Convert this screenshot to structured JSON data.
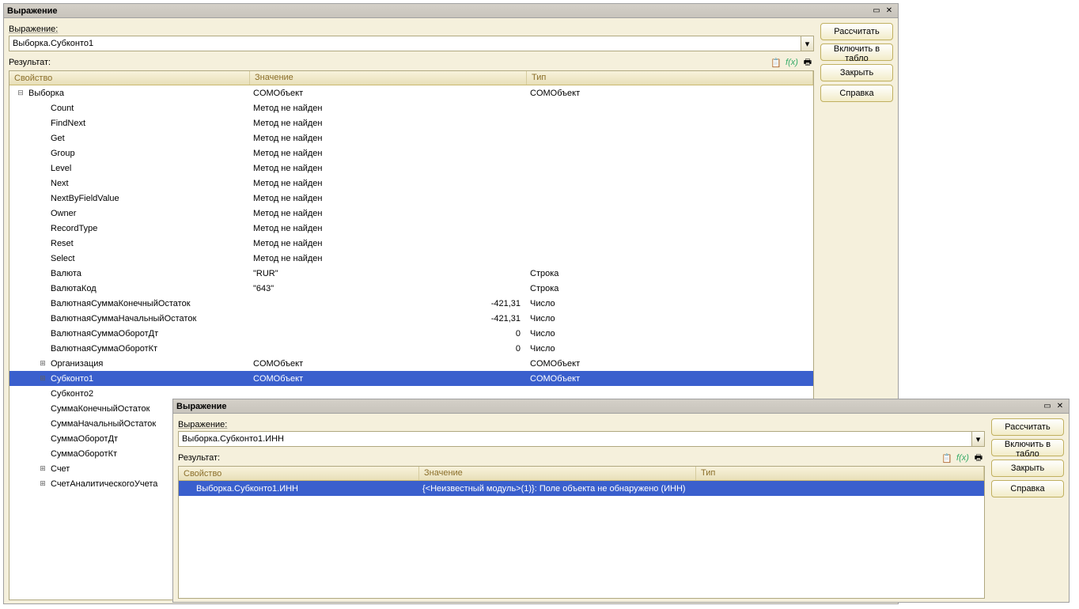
{
  "window1": {
    "title": "Выражение",
    "expression_label": "Выражение:",
    "expression_value": "Выборка.Субконто1",
    "result_label": "Результат:",
    "columns": {
      "c1": "Свойство",
      "c2": "Значение",
      "c3": "Тип"
    },
    "rows": [
      {
        "exp": "minus",
        "indent": 0,
        "c1": "Выборка",
        "c2": "COMОбъект",
        "c3": "COMОбъект"
      },
      {
        "exp": "",
        "indent": 1,
        "c1": "Count",
        "c2": "Метод не найден",
        "c3": ""
      },
      {
        "exp": "",
        "indent": 1,
        "c1": "FindNext",
        "c2": "Метод не найден",
        "c3": ""
      },
      {
        "exp": "",
        "indent": 1,
        "c1": "Get",
        "c2": "Метод не найден",
        "c3": ""
      },
      {
        "exp": "",
        "indent": 1,
        "c1": "Group",
        "c2": "Метод не найден",
        "c3": ""
      },
      {
        "exp": "",
        "indent": 1,
        "c1": "Level",
        "c2": "Метод не найден",
        "c3": ""
      },
      {
        "exp": "",
        "indent": 1,
        "c1": "Next",
        "c2": "Метод не найден",
        "c3": ""
      },
      {
        "exp": "",
        "indent": 1,
        "c1": "NextByFieldValue",
        "c2": "Метод не найден",
        "c3": ""
      },
      {
        "exp": "",
        "indent": 1,
        "c1": "Owner",
        "c2": "Метод не найден",
        "c3": ""
      },
      {
        "exp": "",
        "indent": 1,
        "c1": "RecordType",
        "c2": "Метод не найден",
        "c3": ""
      },
      {
        "exp": "",
        "indent": 1,
        "c1": "Reset",
        "c2": "Метод не найден",
        "c3": ""
      },
      {
        "exp": "",
        "indent": 1,
        "c1": "Select",
        "c2": "Метод не найден",
        "c3": ""
      },
      {
        "exp": "",
        "indent": 1,
        "c1": "Валюта",
        "c2": "\"RUR\"",
        "c3": "Строка"
      },
      {
        "exp": "",
        "indent": 1,
        "c1": "ВалютаКод",
        "c2": "\"643\"",
        "c3": "Строка"
      },
      {
        "exp": "",
        "indent": 1,
        "c1": "ВалютнаяСуммаКонечныйОстаток",
        "c2n": "-421,31",
        "c3": "Число"
      },
      {
        "exp": "",
        "indent": 1,
        "c1": "ВалютнаяСуммаНачальныйОстаток",
        "c2n": "-421,31",
        "c3": "Число"
      },
      {
        "exp": "",
        "indent": 1,
        "c1": "ВалютнаяСуммаОборотДт",
        "c2n": "0",
        "c3": "Число"
      },
      {
        "exp": "",
        "indent": 1,
        "c1": "ВалютнаяСуммаОборотКт",
        "c2n": "0",
        "c3": "Число"
      },
      {
        "exp": "plus",
        "indent": 1,
        "c1": "Организация",
        "c2": "COMОбъект",
        "c3": "COMОбъект"
      },
      {
        "exp": "plus",
        "indent": 1,
        "c1": "Субконто1",
        "c2": "COMОбъект",
        "c3": "COMОбъект",
        "selected": true
      },
      {
        "exp": "",
        "indent": 1,
        "c1": "Субконто2",
        "c2": "",
        "c3": ""
      },
      {
        "exp": "",
        "indent": 1,
        "c1": "СуммаКонечныйОстаток",
        "c2": "",
        "c3": ""
      },
      {
        "exp": "",
        "indent": 1,
        "c1": "СуммаНачальныйОстаток",
        "c2": "",
        "c3": ""
      },
      {
        "exp": "",
        "indent": 1,
        "c1": "СуммаОборотДт",
        "c2": "",
        "c3": ""
      },
      {
        "exp": "",
        "indent": 1,
        "c1": "СуммаОборотКт",
        "c2": "",
        "c3": ""
      },
      {
        "exp": "plus",
        "indent": 1,
        "c1": "Счет",
        "c2": "",
        "c3": ""
      },
      {
        "exp": "plus",
        "indent": 1,
        "c1": "СчетАналитическогоУчета",
        "c2": "",
        "c3": ""
      }
    ],
    "buttons": {
      "calc": "Рассчитать",
      "tablo": "Включить в табло",
      "close": "Закрыть",
      "help": "Справка"
    }
  },
  "window2": {
    "title": "Выражение",
    "expression_label": "Выражение:",
    "expression_value": "Выборка.Субконто1.ИНН",
    "result_label": "Результат:",
    "columns": {
      "c1": "Свойство",
      "c2": "Значение",
      "c3": "Тип"
    },
    "rows": [
      {
        "c1": "Выборка.Субконто1.ИНН",
        "c2": "{<Неизвестный модуль>(1)}: Поле объекта не обнаружено (ИНН)",
        "c3": "",
        "selected": true
      }
    ],
    "buttons": {
      "calc": "Рассчитать",
      "tablo": "Включить в табло",
      "close": "Закрыть",
      "help": "Справка"
    }
  }
}
